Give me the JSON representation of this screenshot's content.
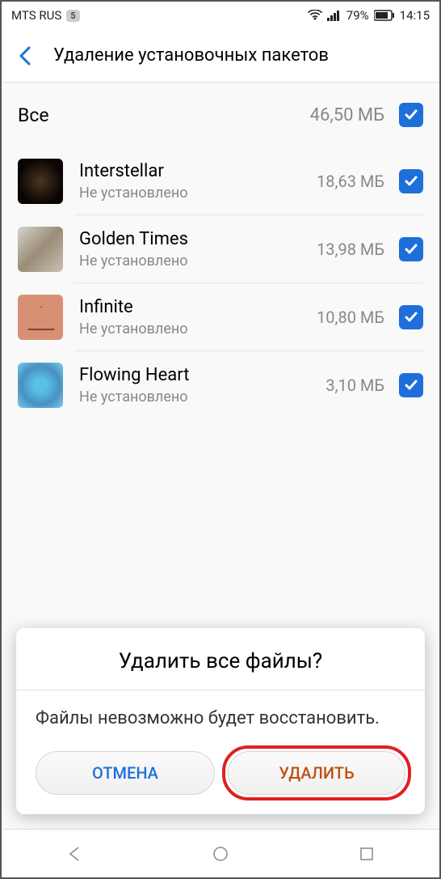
{
  "status": {
    "carrier": "MTS RUS",
    "sim": "5",
    "battery": "79%",
    "time": "14:15"
  },
  "header": {
    "title": "Удаление установочных пакетов"
  },
  "all": {
    "label": "Все",
    "size": "46,50 МБ"
  },
  "items": [
    {
      "name": "Interstellar",
      "status": "Не установлено",
      "size": "18,63 МБ",
      "icon": "interstellar"
    },
    {
      "name": "Golden Times",
      "status": "Не установлено",
      "size": "13,98 МБ",
      "icon": "golden"
    },
    {
      "name": "Infinite",
      "status": "Не установлено",
      "size": "10,80 МБ",
      "icon": "infinite"
    },
    {
      "name": "Flowing Heart",
      "status": "Не установлено",
      "size": "3,10 МБ",
      "icon": "flowing"
    }
  ],
  "dialog": {
    "title": "Удалить все файлы?",
    "message": "Файлы невозможно будет восстановить.",
    "cancel": "ОТМЕНА",
    "delete": "УДАЛИТЬ"
  }
}
